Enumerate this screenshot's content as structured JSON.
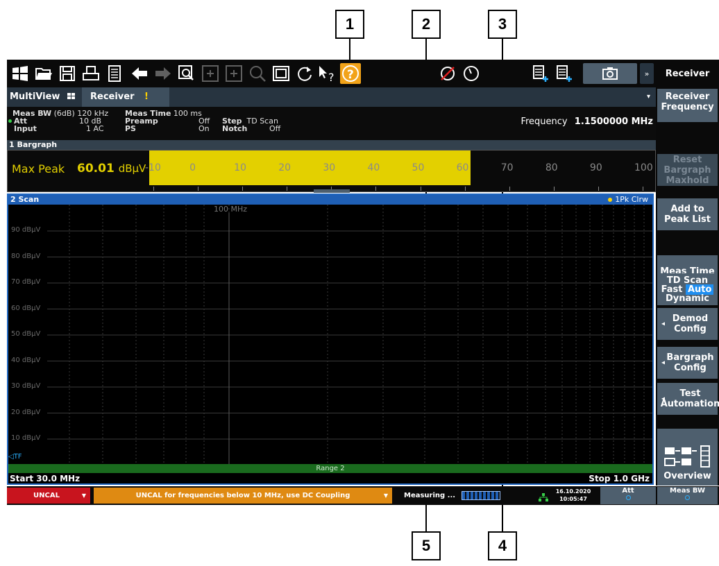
{
  "callouts": [
    "1",
    "2",
    "3",
    "4",
    "5"
  ],
  "toolbar": {
    "icons": [
      "windows-icon",
      "open-folder-icon",
      "save-icon",
      "print-icon",
      "document-icon",
      "undo-icon",
      "redo-icon",
      "zoom-icon",
      "zoom-in-icon",
      "multi-zoom-icon",
      "zoom-off-icon",
      "full-screen-icon",
      "refresh-icon",
      "help-pointer-icon",
      "help-icon",
      "signal-off-icon",
      "dial-icon",
      "add-window-icon",
      "add-window-2-icon",
      "camera-icon",
      "more-icon"
    ]
  },
  "softkeys": {
    "title": "Receiver",
    "receiver_frequency": "Receiver Frequency",
    "reset_bargraph": "Reset Bargraph Maxhold",
    "add_peak": "Add to Peak List",
    "meas_time": "Meas Time",
    "td_scan": "TD Scan",
    "td_fast": "Fast",
    "td_auto": "Auto",
    "td_dynamic": "Dynamic",
    "demod_config": "Demod Config",
    "bargraph_config": "Bargraph Config",
    "test_automation": "Test Automation",
    "overview": "Overview"
  },
  "tabs": {
    "multiview": "MultiView",
    "receiver": "Receiver",
    "warning": "!",
    "dropdown": "▾"
  },
  "settings": {
    "meas_bw_label": "Meas BW",
    "meas_bw_value": "(6dB) 120 kHz",
    "att_label": "Att",
    "att_value": "10 dB",
    "input_label": "Input",
    "input_value": "1 AC",
    "meas_time_label": "Meas Time",
    "meas_time_value": "100 ms",
    "preamp_label": "Preamp",
    "preamp_value": "Off",
    "ps_label": "PS",
    "ps_value": "On",
    "step_label": "Step",
    "step_value": "TD Scan",
    "notch_label": "Notch",
    "notch_value": "Off",
    "frequency_label": "Frequency",
    "frequency_value": "1.1500000 MHz"
  },
  "bargraph": {
    "title": "1 Bargraph",
    "detector": "Max Peak",
    "value": "60.01",
    "unit": "dBµV",
    "level_db": 60.01,
    "scale_min": -10,
    "scale_max": 100,
    "ticks": [
      "-10",
      "0",
      "10",
      "20",
      "30",
      "40",
      "50",
      "60",
      "70",
      "80",
      "90",
      "100"
    ],
    "fill_color": "#e3d000"
  },
  "scan": {
    "title": "2 Scan",
    "trace_label": "1Pk Clrw",
    "marker_freq": "100 MHz",
    "y_labels": [
      "90 dBµV",
      "80 dBµV",
      "70 dBµV",
      "60 dBµV",
      "50 dBµV",
      "40 dBµV",
      "30 dBµV",
      "20 dBµV",
      "10 dBµV"
    ],
    "tf_label": "TF",
    "range_label": "Range 2",
    "start": "Start 30.0 MHz",
    "stop": "Stop 1.0 GHz"
  },
  "statusbar": {
    "uncal": "UNCAL",
    "message": "UNCAL for frequencies below 10 MHz, use DC Coupling",
    "measuring": "Measuring ...",
    "date": "16.10.2020",
    "time": "10:05:47",
    "att": "Att",
    "meas_bw": "Meas BW"
  },
  "colors": {
    "uncal_bg": "#c8141e",
    "message_bg": "#df8a12",
    "bar_fill": "#e3d000",
    "accent_blue": "#1f5fb5"
  }
}
